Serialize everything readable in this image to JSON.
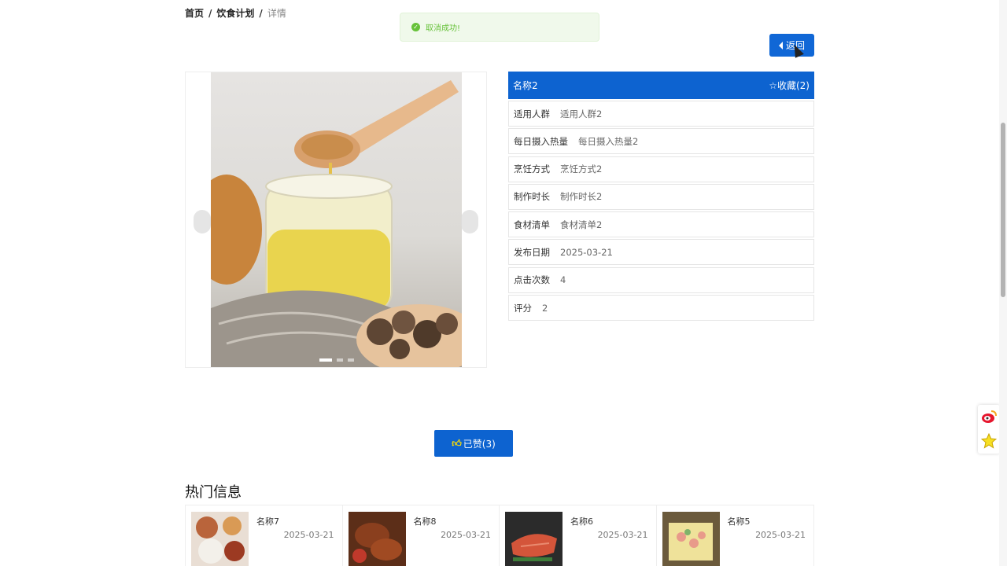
{
  "breadcrumb": {
    "home": "首页",
    "sep": "/",
    "section": "饮食计划",
    "current": "详情"
  },
  "toast": {
    "message": "取消成功!"
  },
  "back_button": {
    "label": "返回"
  },
  "carousel": {
    "slide_count": 3,
    "active_index": 0
  },
  "detail": {
    "name": "名称2",
    "favorite_label": "☆收藏(2)",
    "rows": [
      {
        "key": "适用人群",
        "value": "适用人群2"
      },
      {
        "key": "每日摄入热量",
        "value": "每日摄入热量2"
      },
      {
        "key": "烹饪方式",
        "value": "烹饪方式2"
      },
      {
        "key": "制作时长",
        "value": "制作时长2"
      },
      {
        "key": "食材清单",
        "value": "食材清单2"
      },
      {
        "key": "发布日期",
        "value": "2025-03-21"
      },
      {
        "key": "点击次数",
        "value": "4"
      },
      {
        "key": "评分",
        "value": "2"
      }
    ]
  },
  "like_button": {
    "icon": "thumb-icon",
    "label": "已赞(3)"
  },
  "hot": {
    "title": "热门信息",
    "items": [
      {
        "name": "名称7",
        "date": "2025-03-21"
      },
      {
        "name": "名称8",
        "date": "2025-03-21"
      },
      {
        "name": "名称6",
        "date": "2025-03-21"
      },
      {
        "name": "名称5",
        "date": "2025-03-21"
      }
    ]
  },
  "colors": {
    "primary": "#0d63d0",
    "toast_bg": "#f0f9eb",
    "toast_text": "#67c23a",
    "like_icon": "#ffe000"
  }
}
